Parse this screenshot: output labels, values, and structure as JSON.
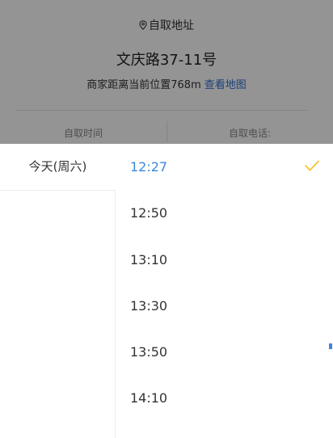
{
  "pickup": {
    "label": "自取地址",
    "address": "文庆路37-11号",
    "distance_text": "商家距离当前位置768m",
    "map_link": "查看地图",
    "time_label": "自取时间",
    "phone_label": "自取电话:"
  },
  "picker": {
    "day": "今天(周六)",
    "times": [
      {
        "label": "12:27",
        "selected": true
      },
      {
        "label": "12:50",
        "selected": false
      },
      {
        "label": "13:10",
        "selected": false
      },
      {
        "label": "13:30",
        "selected": false
      },
      {
        "label": "13:50",
        "selected": false
      },
      {
        "label": "14:10",
        "selected": false
      }
    ]
  },
  "colors": {
    "accent_yellow": "#f5c42c",
    "selected_blue": "#3d88d8",
    "link_blue": "#2f6fd0",
    "check_yellow": "#f5c42c"
  },
  "icons": {
    "pin": "location-pin-icon",
    "check": "checkmark-icon"
  }
}
